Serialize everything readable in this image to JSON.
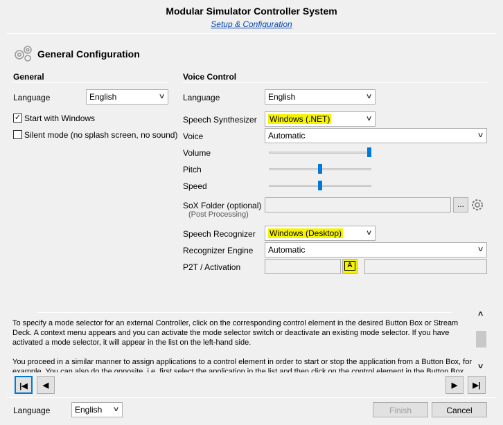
{
  "window": {
    "title": "Modular Simulator Controller System",
    "subtitle": "Setup & Configuration"
  },
  "page": {
    "title": "General Configuration",
    "icon": "gears-icon"
  },
  "general": {
    "group_title": "General",
    "language_label": "Language",
    "language_value": "English",
    "start_with_windows_label": "Start with Windows",
    "start_with_windows_checked": true,
    "silent_mode_label": "Silent mode (no splash screen, no sound)",
    "silent_mode_checked": false
  },
  "voice": {
    "group_title": "Voice Control",
    "language_label": "Language",
    "language_value": "English",
    "synth_label": "Speech Synthesizer",
    "synth_value": "Windows (.NET)",
    "voice_label": "Voice",
    "voice_value": "Automatic",
    "volume_label": "Volume",
    "volume_level": 1.0,
    "pitch_label": "Pitch",
    "pitch_level": 0.5,
    "speed_label": "Speed",
    "speed_level": 0.5,
    "sox_label": "SoX Folder (optional)",
    "sox_sublabel": "(Post Processing)",
    "sox_value": "",
    "browse_label": "...",
    "recognizer_label": "Speech Recognizer",
    "recognizer_value": "Windows (Desktop)",
    "engine_label": "Recognizer Engine",
    "engine_value": "Automatic",
    "p2t_label": "P2T / Activation",
    "p2t_value": "",
    "activation_value": "",
    "p2t_button_glyph": "A"
  },
  "help": {
    "paragraph1": "To specify a mode selector for an external Controller, click on the corresponding control element in the desired Button Box or Stream Deck. A context menu appears and you can activate the mode selector switch or deactivate an existing mode selector. If you have activated a mode selector, it will appear in the list on the left-hand side.",
    "paragraph2": "You proceed in a similar manner to assign applications to a control element in order to start or stop the application from a Button Box, for example. You can also do the opposite, i.e. first select the application in the list and then click on the control element in the Button Box."
  },
  "nav": {
    "first_glyph": "|◀",
    "prev_glyph": "◀",
    "next_glyph": "▶",
    "last_glyph": "▶|"
  },
  "footer": {
    "language_label": "Language",
    "language_value": "English",
    "finish_label": "Finish",
    "cancel_label": "Cancel"
  },
  "colors": {
    "highlight": "#f6f300",
    "accent": "#0078d7",
    "link": "#0645ad"
  }
}
